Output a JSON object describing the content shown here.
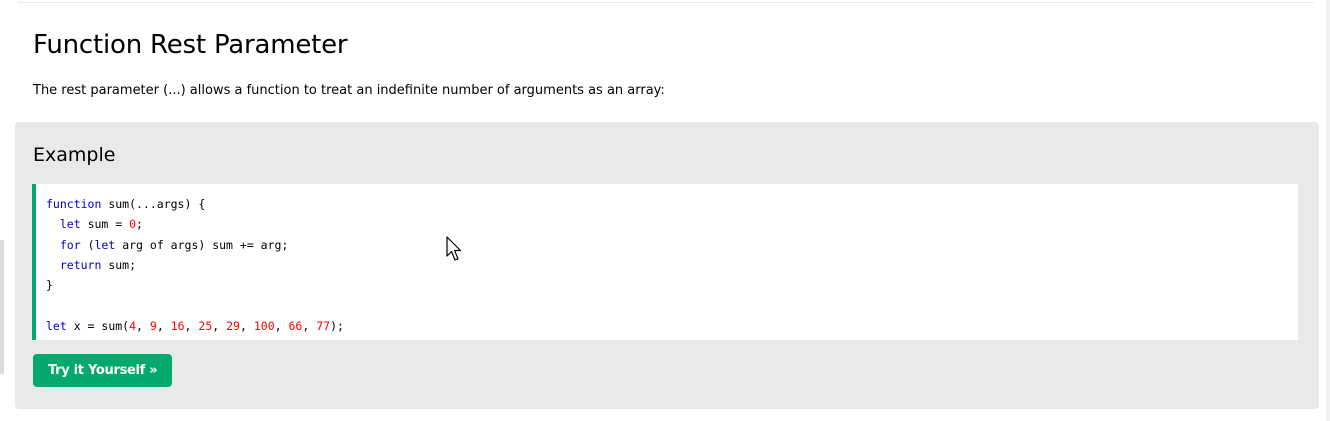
{
  "header": {
    "title": "Function Rest Parameter",
    "intro": "The rest parameter (...) allows a function to treat an indefinite number of arguments as an array:"
  },
  "example": {
    "heading": "Example",
    "code_lines": [
      {
        "tokens": [
          {
            "t": "kw",
            "v": "function"
          },
          {
            "t": "plain",
            "v": " sum(...args) {"
          }
        ]
      },
      {
        "tokens": [
          {
            "t": "plain",
            "v": "  "
          },
          {
            "t": "kw",
            "v": "let"
          },
          {
            "t": "plain",
            "v": " sum = "
          },
          {
            "t": "num",
            "v": "0"
          },
          {
            "t": "plain",
            "v": ";"
          }
        ]
      },
      {
        "tokens": [
          {
            "t": "plain",
            "v": "  "
          },
          {
            "t": "kw",
            "v": "for"
          },
          {
            "t": "plain",
            "v": " ("
          },
          {
            "t": "kw",
            "v": "let"
          },
          {
            "t": "plain",
            "v": " arg of args) sum += arg;"
          }
        ]
      },
      {
        "tokens": [
          {
            "t": "plain",
            "v": "  "
          },
          {
            "t": "kw",
            "v": "return"
          },
          {
            "t": "plain",
            "v": " sum;"
          }
        ]
      },
      {
        "tokens": [
          {
            "t": "plain",
            "v": "}"
          }
        ]
      },
      {
        "tokens": []
      },
      {
        "tokens": [
          {
            "t": "kw",
            "v": "let"
          },
          {
            "t": "plain",
            "v": " x = sum("
          },
          {
            "t": "num",
            "v": "4"
          },
          {
            "t": "plain",
            "v": ", "
          },
          {
            "t": "num",
            "v": "9"
          },
          {
            "t": "plain",
            "v": ", "
          },
          {
            "t": "num",
            "v": "16"
          },
          {
            "t": "plain",
            "v": ", "
          },
          {
            "t": "num",
            "v": "25"
          },
          {
            "t": "plain",
            "v": ", "
          },
          {
            "t": "num",
            "v": "29"
          },
          {
            "t": "plain",
            "v": ", "
          },
          {
            "t": "num",
            "v": "100"
          },
          {
            "t": "plain",
            "v": ", "
          },
          {
            "t": "num",
            "v": "66"
          },
          {
            "t": "plain",
            "v": ", "
          },
          {
            "t": "num",
            "v": "77"
          },
          {
            "t": "plain",
            "v": ");"
          }
        ]
      }
    ],
    "try_button_label": "Try it Yourself »"
  },
  "colors": {
    "accent_green": "#04aa6d",
    "example_bg": "#e7e9eb",
    "keyword": "#0000cd",
    "number": "#ff0000"
  },
  "icons": {
    "cursor": "mouse-pointer-icon"
  }
}
